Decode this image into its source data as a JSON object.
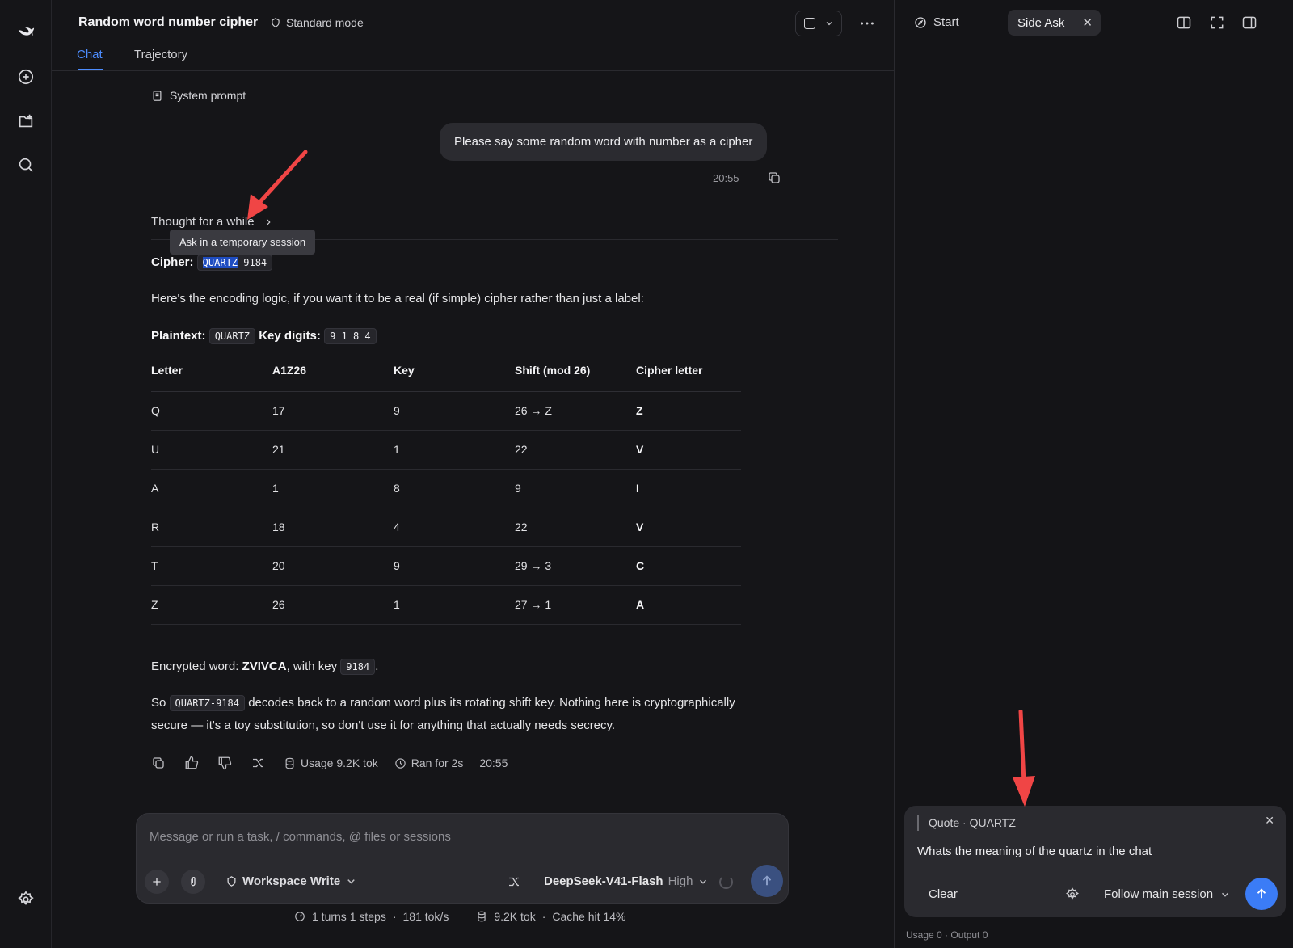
{
  "header": {
    "title": "Random word number cipher",
    "mode": "Standard mode",
    "tabs": [
      "Chat",
      "Trajectory"
    ]
  },
  "chat": {
    "system_prompt": "System prompt",
    "user_message": "Please say some random word with number as a cipher",
    "user_time": "20:55",
    "thought": "Thought for a while",
    "tooltip": "Ask in a temporary session",
    "cipher_label": "Cipher:",
    "cipher_hl": "QUARTZ",
    "cipher_rest": "-9184",
    "intro": "Here's the encoding logic, if you want it to be a real (if simple) cipher rather than just a label:",
    "plaintext_label": "Plaintext:",
    "plaintext_value": "QUARTZ",
    "key_label": "Key digits:",
    "key_value": "9 1 8 4",
    "table": {
      "headers": [
        "Letter",
        "A1Z26",
        "Key",
        "Shift (mod 26)",
        "Cipher letter"
      ],
      "rows": [
        [
          "Q",
          "17",
          "9",
          "26 → Z",
          "Z"
        ],
        [
          "U",
          "21",
          "1",
          "22",
          "V"
        ],
        [
          "A",
          "1",
          "8",
          "9",
          "I"
        ],
        [
          "R",
          "18",
          "4",
          "22",
          "V"
        ],
        [
          "T",
          "20",
          "9",
          "29 → 3",
          "C"
        ],
        [
          "Z",
          "26",
          "1",
          "27 → 1",
          "A"
        ]
      ]
    },
    "encrypted_prefix": "Encrypted word:",
    "encrypted_word": "ZVIVCA",
    "encrypted_mid": ", with key",
    "encrypted_key": "9184",
    "encrypted_suffix": ".",
    "closing_prefix": "So",
    "closing_code": "QUARTZ-9184",
    "closing_line1": "decodes back to a random word plus its rotating shift key. Nothing here is cryptographically",
    "closing_line2": "secure — it's a toy substitution, so don't use it for anything that actually needs secrecy.",
    "usage": "Usage 9.2K tok",
    "ran_for": "Ran for 2s",
    "reply_time": "20:55"
  },
  "composer": {
    "placeholder": "Message or run a task, / commands, @ files or sessions",
    "workspace": "Workspace Write",
    "model": "DeepSeek-V41-Flash",
    "level": "High"
  },
  "footer": {
    "turns": "1 turns 1 steps",
    "speed": "181 tok/s",
    "tokens": "9.2K tok",
    "cache": "Cache hit 14%",
    "sep": "·"
  },
  "side": {
    "start": "Start",
    "tab": "Side Ask",
    "quote_label": "Quote · QUARTZ",
    "question": "Whats the meaning of the quartz in the chat",
    "clear": "Clear",
    "follow": "Follow main session",
    "usage": "Usage 0 · Output 0"
  },
  "colors": {
    "accent": "#4d8dff",
    "highlight": "#1f4dc1",
    "send_active": "#3b7cf6",
    "annotation_arrow": "#f04545"
  }
}
